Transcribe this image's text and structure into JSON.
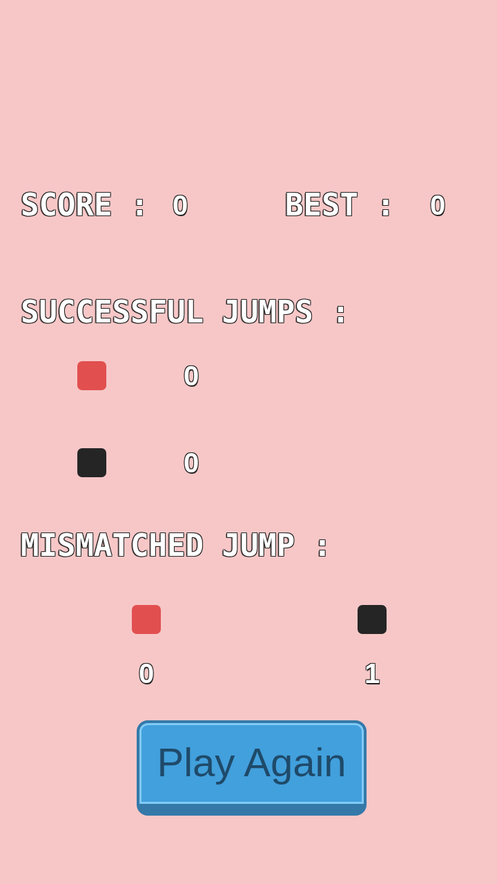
{
  "score": {
    "label": "SCORE :",
    "value": "0"
  },
  "best": {
    "label": "BEST :",
    "value": "0"
  },
  "successful_jumps": {
    "title": "SUCCESSFUL JUMPS :",
    "items": [
      {
        "color": "#e24f4f",
        "count": "0"
      },
      {
        "color": "#252525",
        "count": "0"
      }
    ]
  },
  "mismatched_jump": {
    "title": "MISMATCHED JUMP :",
    "items": [
      {
        "color": "#e24f4f",
        "count": "0"
      },
      {
        "color": "#252525",
        "count": "1"
      }
    ]
  },
  "button": {
    "label": "Play Again"
  }
}
